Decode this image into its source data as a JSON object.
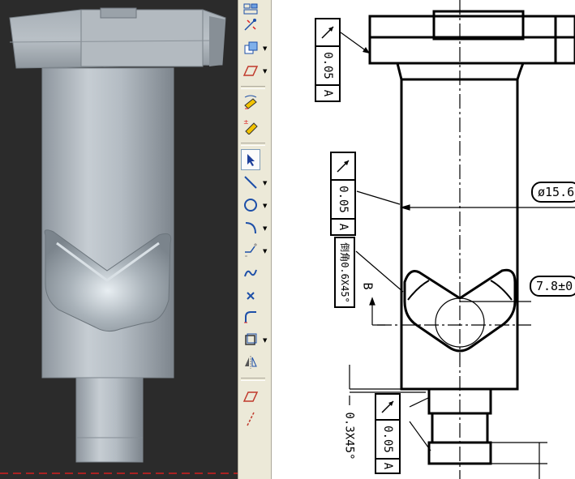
{
  "viewport": {
    "label": "3d-model-viewport",
    "background": "#2b2b2b",
    "part_color": "#a8b0b8"
  },
  "toolbar": {
    "buttons": [
      {
        "icon": "view-icon",
        "has_dropdown": false
      },
      {
        "icon": "smart-dimension-icon",
        "has_dropdown": false
      },
      {
        "icon": "display-style-icon",
        "has_dropdown": true
      },
      {
        "icon": "sketch-plane-icon",
        "has_dropdown": true
      },
      {
        "icon": "annotation-icon",
        "has_dropdown": false
      },
      {
        "icon": "dimension-xyz-icon",
        "has_dropdown": false
      },
      {
        "icon": "select-pointer-icon",
        "has_dropdown": false,
        "active": true
      },
      {
        "icon": "line-tool-icon",
        "has_dropdown": true
      },
      {
        "icon": "circle-tool-icon",
        "has_dropdown": true
      },
      {
        "icon": "arc-tool-icon",
        "has_dropdown": true
      },
      {
        "icon": "centerline-icon",
        "has_dropdown": true
      },
      {
        "icon": "spline-tool-icon",
        "has_dropdown": false
      },
      {
        "icon": "point-tool-icon",
        "has_dropdown": false
      },
      {
        "icon": "fillet-tool-icon",
        "has_dropdown": false
      },
      {
        "icon": "offset-tool-icon",
        "has_dropdown": true
      },
      {
        "icon": "mirror-tool-icon",
        "has_dropdown": false
      },
      {
        "icon": "plane-icon",
        "has_dropdown": false
      },
      {
        "icon": "construction-line-icon",
        "has_dropdown": false
      }
    ]
  },
  "drawing": {
    "gdt_frames": [
      {
        "tolerance": "0.05",
        "datum": "A"
      },
      {
        "tolerance": "0.05",
        "datum": "A"
      },
      {
        "tolerance": "0.05",
        "datum": "A"
      }
    ],
    "diameter_dim": "ø15.6",
    "position_dim": "7.8±0",
    "chamfer_note": "倒角0.6X45°",
    "bottom_chamfer": "0.3X45°",
    "section_label": "B"
  }
}
